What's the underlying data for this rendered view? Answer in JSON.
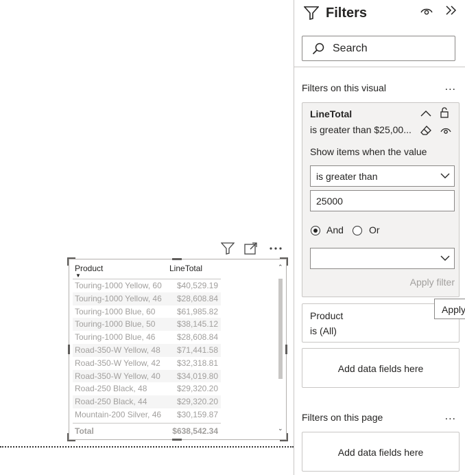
{
  "visual": {
    "headers": {
      "product": "Product",
      "linetotal": "LineTotal"
    },
    "rows": [
      {
        "product": "Touring-1000 Yellow, 60",
        "linetotal": "$40,529.19"
      },
      {
        "product": "Touring-1000 Yellow, 46",
        "linetotal": "$28,608.84"
      },
      {
        "product": "Touring-1000 Blue, 60",
        "linetotal": "$61,985.82"
      },
      {
        "product": "Touring-1000 Blue, 50",
        "linetotal": "$38,145.12"
      },
      {
        "product": "Touring-1000 Blue, 46",
        "linetotal": "$28,608.84"
      },
      {
        "product": "Road-350-W Yellow, 48",
        "linetotal": "$71,441.58"
      },
      {
        "product": "Road-350-W Yellow, 42",
        "linetotal": "$32,318.81"
      },
      {
        "product": "Road-350-W Yellow, 40",
        "linetotal": "$34,019.80"
      },
      {
        "product": "Road-250 Black, 48",
        "linetotal": "$29,320.20"
      },
      {
        "product": "Road-250 Black, 44",
        "linetotal": "$29,320.20"
      },
      {
        "product": "Mountain-200 Silver, 46",
        "linetotal": "$30,159.87"
      }
    ],
    "total": {
      "label": "Total",
      "value": "$638,542.34"
    },
    "header_icons": [
      "filter-icon",
      "focus-mode-icon",
      "more-options-icon"
    ]
  },
  "filters_pane": {
    "title": "Filters",
    "search_placeholder": "Search",
    "visual_section": "Filters on this visual",
    "page_section": "Filters on this page",
    "more_label": "...",
    "linetotal_card": {
      "field": "LineTotal",
      "summary": "is greater than $25,00...",
      "show_items_label": "Show items when the value",
      "condition": "is greater than",
      "value": "25000",
      "and_label": "And",
      "or_label": "Or",
      "second_condition": "",
      "apply_label": "Apply filter"
    },
    "product_card": {
      "field": "Product",
      "summary": "is (All)"
    },
    "add_fields_label": "Add data fields here",
    "add_fields_label_page": "Add data fields here"
  },
  "tooltip": "Apply filter",
  "colors": {
    "accent": "#252423",
    "muted": "#a19f9d",
    "card_bg": "#f3f2f1"
  }
}
